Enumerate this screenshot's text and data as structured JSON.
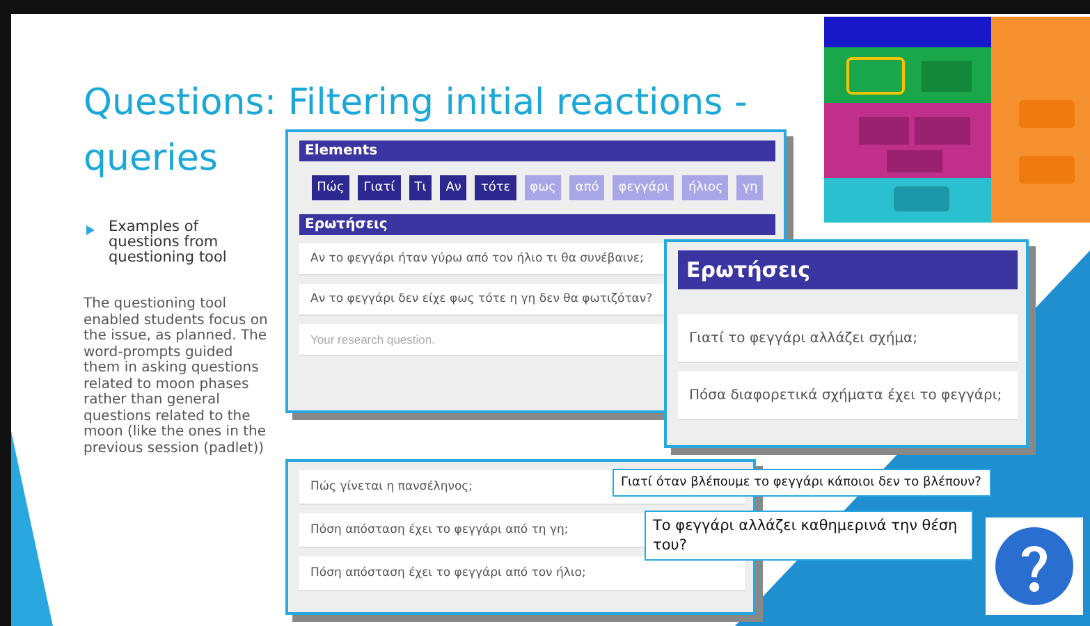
{
  "slide": {
    "title_lines": [
      "Questions: Filtering initial reactions -",
      "queries"
    ],
    "bullet": "Examples of questions from questioning tool",
    "body": "The questioning tool enabled students focus on the issue, as planned. The word-prompts guided them in asking questions related to moon phases rather than general questions related to the moon (like the ones in the previous session (padlet))"
  },
  "tool_panel": {
    "elements_header": "Elements",
    "words": [
      {
        "label": "Πώς",
        "active": true
      },
      {
        "label": "Γιατί",
        "active": true
      },
      {
        "label": "Τι",
        "active": true
      },
      {
        "label": "Αν",
        "active": true
      },
      {
        "label": "τότε",
        "active": true
      },
      {
        "label": "φως",
        "active": false
      },
      {
        "label": "από",
        "active": false
      },
      {
        "label": "φεγγάρι",
        "active": false
      },
      {
        "label": "ήλιος",
        "active": false
      },
      {
        "label": "γη",
        "active": false
      }
    ],
    "questions_header": "Ερωτήσεις",
    "questions": [
      "Αν το φεγγάρι ήταν γύρω από τον ήλιο τι θα συνέβαινε;",
      "Αν το φεγγάρι δεν είχε φως τότε η γη δεν θα φωτιζόταν?"
    ],
    "placeholder": "Your research question."
  },
  "zoom_panel": {
    "header": "Ερωτήσεις",
    "questions": [
      "Γιατί το φεγγάρι αλλάζει σχήμα;",
      "Πόσα διαφορετικά σχήματα έχει το φεγγάρι;"
    ]
  },
  "list_panel": {
    "questions": [
      "Πώς γίνεται η πανσέληνος;",
      "Πόση απόσταση έχει το φεγγάρι από τη γη;",
      "Πόση απόσταση έχει το φεγγάρι από τον ήλιο;"
    ]
  },
  "callouts": [
    "Γιατί όταν βλέπουμε το φεγγάρι κάποιοι δεν το βλέπουν?",
    "Το φεγγάρι αλλάζει καθημερινά την θέση του?"
  ]
}
